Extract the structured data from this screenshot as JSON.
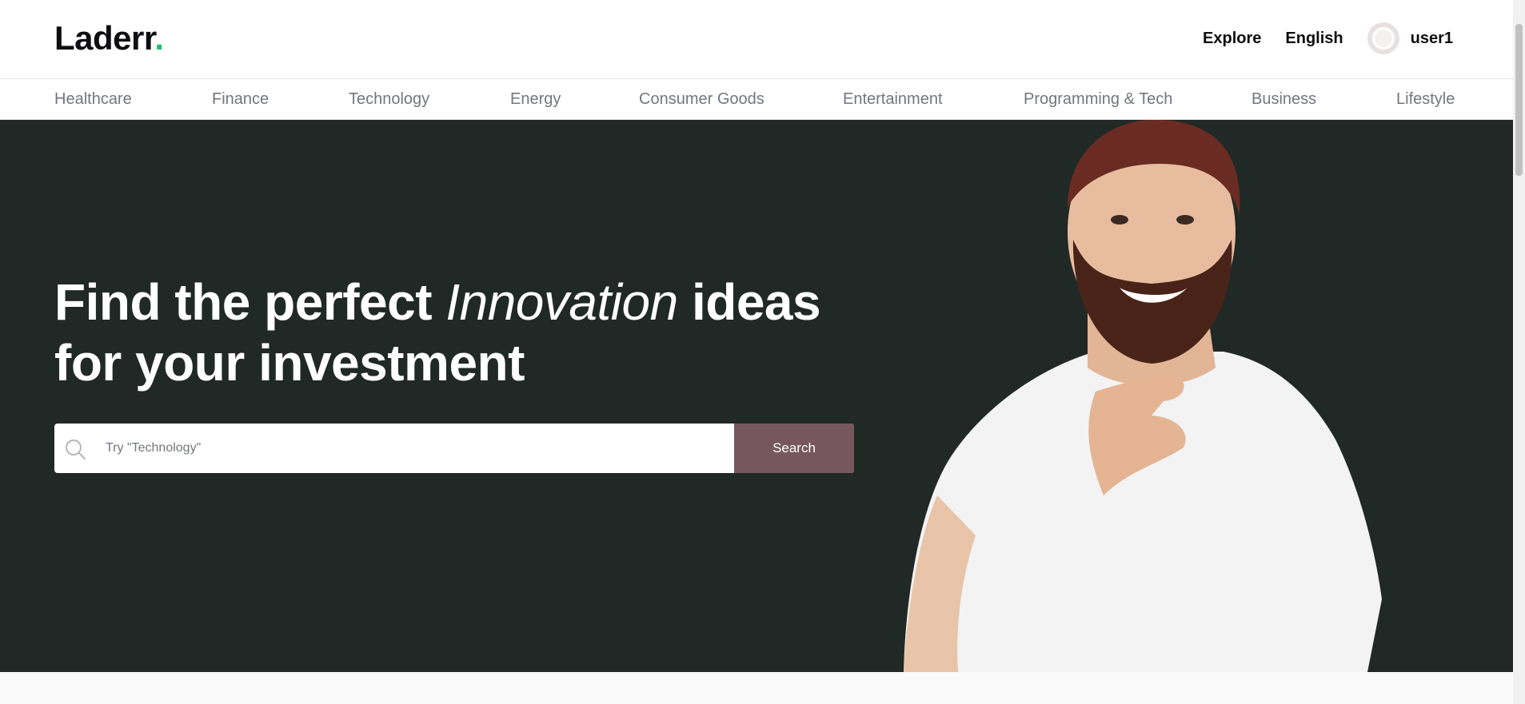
{
  "header": {
    "logo_text": "Laderr",
    "logo_dot": ".",
    "nav": {
      "explore": "Explore",
      "language": "English",
      "username": "user1"
    }
  },
  "categories": [
    "Healthcare",
    "Finance",
    "Technology",
    "Energy",
    "Consumer Goods",
    "Entertainment",
    "Programming & Tech",
    "Business",
    "Lifestyle"
  ],
  "hero": {
    "headline_part1": "Find the perfect ",
    "headline_italic": "Innovation",
    "headline_part2": " ideas for your investment",
    "search_placeholder": "Try \"Technology\"",
    "search_button": "Search"
  },
  "colors": {
    "brand_dot": "#1dbf73",
    "hero_bg": "#212926",
    "search_button_bg": "#76575f"
  },
  "icons": {
    "search": "search-icon",
    "avatar": "user-avatar-icon"
  }
}
